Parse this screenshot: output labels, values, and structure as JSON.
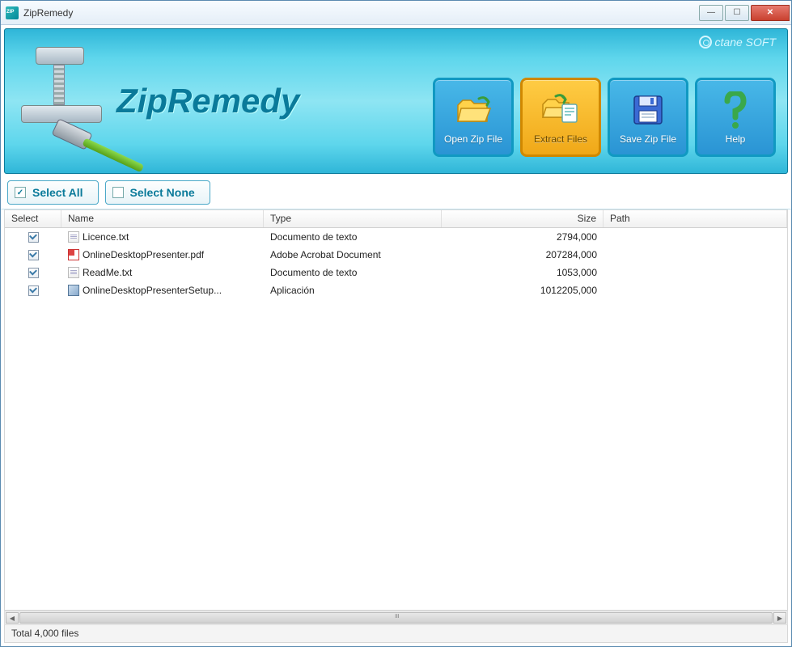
{
  "window": {
    "title": "ZipRemedy"
  },
  "brand": {
    "name": "ZipRemedy",
    "vendor": "ctane SOFT"
  },
  "toolbar": {
    "open": {
      "label": "Open Zip File"
    },
    "extract": {
      "label": "Extract Files"
    },
    "save": {
      "label": "Save Zip File"
    },
    "help": {
      "label": "Help"
    }
  },
  "selection": {
    "select_all": "Select All",
    "select_none": "Select None"
  },
  "table": {
    "headers": {
      "select": "Select",
      "name": "Name",
      "type": "Type",
      "size": "Size",
      "path": "Path"
    },
    "rows": [
      {
        "checked": true,
        "icon": "txt",
        "name": "Licence.txt",
        "type": "Documento de texto",
        "size": "2794,000",
        "path": ""
      },
      {
        "checked": true,
        "icon": "pdf",
        "name": "OnlineDesktopPresenter.pdf",
        "type": "Adobe Acrobat Document",
        "size": "207284,000",
        "path": ""
      },
      {
        "checked": true,
        "icon": "txt",
        "name": "ReadMe.txt",
        "type": "Documento de texto",
        "size": "1053,000",
        "path": ""
      },
      {
        "checked": true,
        "icon": "exe",
        "name": "OnlineDesktopPresenterSetup...",
        "type": "Aplicación",
        "size": "1012205,000",
        "path": ""
      }
    ]
  },
  "status": {
    "text": "Total 4,000 files"
  }
}
